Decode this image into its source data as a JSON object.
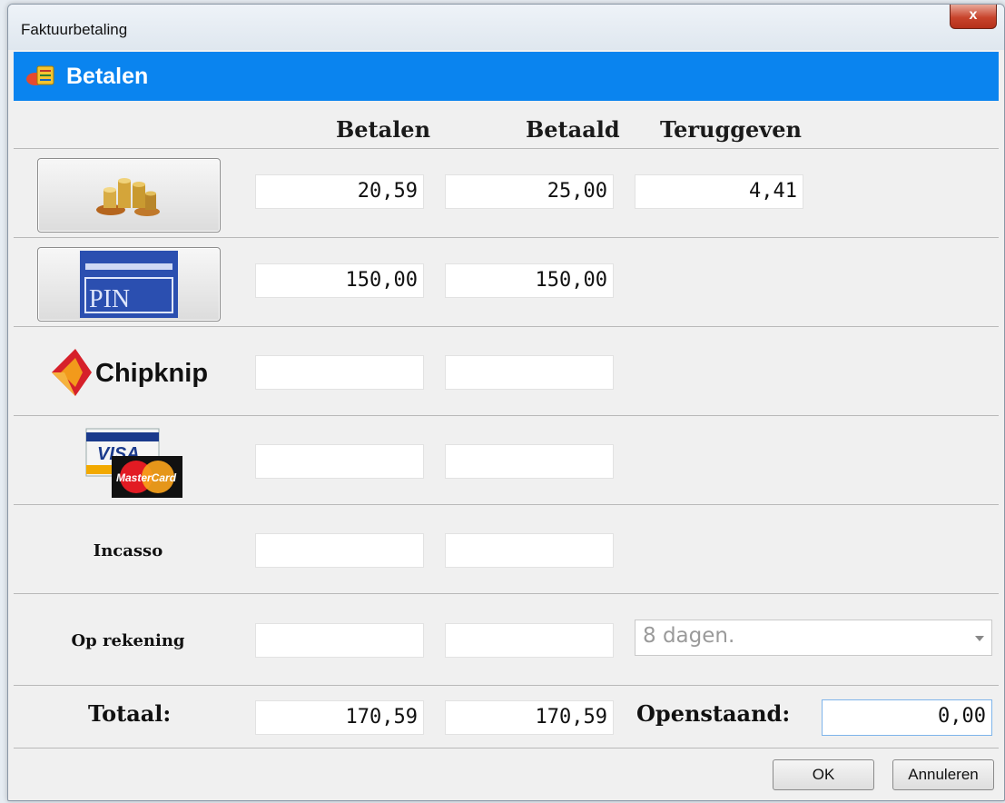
{
  "window": {
    "title": "Faktuurbetaling",
    "close_label": "x"
  },
  "header": {
    "title": "Betalen"
  },
  "columns": {
    "betalen": "Betalen",
    "betaald": "Betaald",
    "teruggeven": "Teruggeven"
  },
  "rows": {
    "contant": {
      "betalen": "20,59",
      "betaald": "25,00",
      "teruggeven": "4,41"
    },
    "pin": {
      "logo_text": "PIN",
      "betalen": "150,00",
      "betaald": "150,00"
    },
    "chipknip": {
      "logo_text": "Chipknip",
      "betalen": "",
      "betaald": ""
    },
    "creditcard": {
      "visa_text": "VISA",
      "mastercard_text": "MasterCard",
      "betalen": "",
      "betaald": ""
    },
    "incasso": {
      "label": "Incasso",
      "betalen": "",
      "betaald": ""
    },
    "op_rekening": {
      "label": "Op rekening",
      "betalen": "",
      "betaald": "",
      "term_selected": "8 dagen."
    }
  },
  "totals": {
    "label": "Totaal:",
    "betalen": "170,59",
    "betaald": "170,59",
    "openstaand_label": "Openstaand:",
    "openstaand": "0,00"
  },
  "buttons": {
    "ok": "OK",
    "cancel": "Annuleren"
  },
  "colors": {
    "header_blue": "#0a84ef",
    "pin_blue": "#2b4fb0",
    "chipknip_red": "#d6202a",
    "chipknip_orange": "#f29a1b"
  }
}
